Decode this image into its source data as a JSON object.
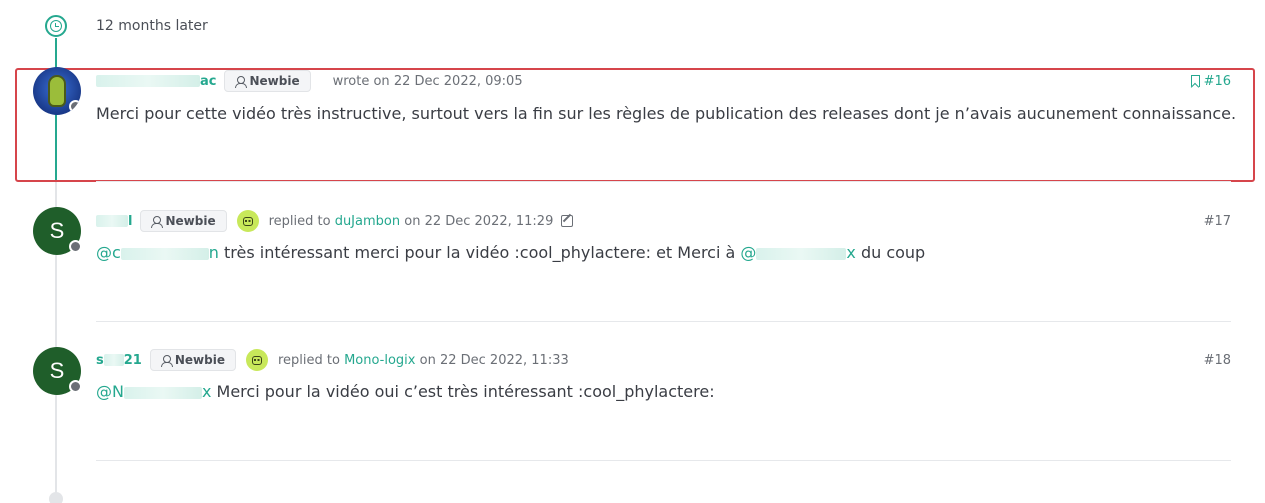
{
  "timeline": {
    "gap_label": "12 months later"
  },
  "posts": [
    {
      "author_visible": "ac",
      "badge": "Newbie",
      "action": "wrote on",
      "date": "22 Dec 2022, 09:05",
      "number": "#16",
      "text": "Merci pour cette vidéo très instructive, surtout vers la fin sur les règles de publication des releases dont je n’avais aucunement connaissance."
    },
    {
      "avatar_letter": "S",
      "author_visible": "l",
      "badge": "Newbie",
      "action": "replied to",
      "reply_to": "duJambon",
      "date_prefix": "on",
      "date": "22 Dec 2022, 11:29",
      "number": "#17",
      "mention_start": "@c",
      "mention_end": "n",
      "text_middle": " très intéressant merci pour la vidéo :cool_phylactere: et Merci à ",
      "mention2_start": "@",
      "mention2_end": "x",
      "text_end": " du coup"
    },
    {
      "avatar_letter": "S",
      "author_start": "s",
      "author_end": "21",
      "badge": "Newbie",
      "action": "replied to",
      "reply_to": "Mono-logix",
      "date_prefix": "on",
      "date": "22 Dec 2022, 11:33",
      "number": "#18",
      "mention_start": "@N",
      "mention_end": "x",
      "text_rest": " Merci pour la vidéo oui c’est très intéressant :cool_phylactere:"
    }
  ]
}
